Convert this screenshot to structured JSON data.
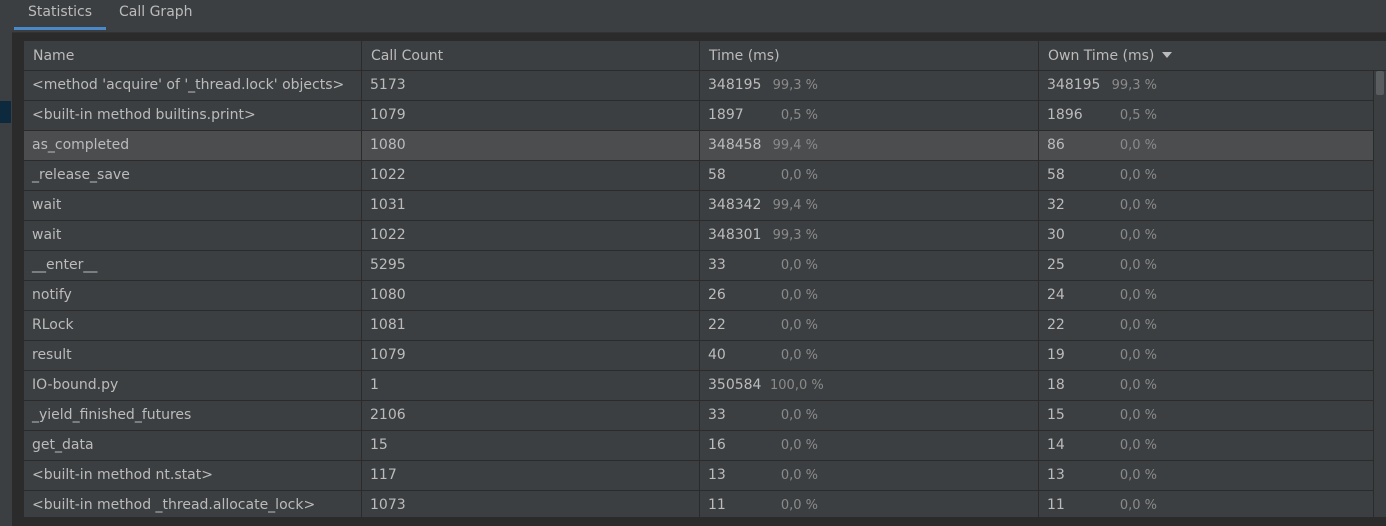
{
  "tabs": [
    {
      "label": "Statistics",
      "active": true
    },
    {
      "label": "Call Graph",
      "active": false
    }
  ],
  "columns": {
    "name": "Name",
    "call_count": "Call Count",
    "time": "Time (ms)",
    "own_time": "Own Time (ms)"
  },
  "rows": [
    {
      "name": "<method 'acquire' of '_thread.lock' objects>",
      "call_count": "5173",
      "time": "348195",
      "time_pct": "99,3 %",
      "own": "348195",
      "own_pct": "99,3 %"
    },
    {
      "name": "<built-in method builtins.print>",
      "call_count": "1079",
      "time": "1897",
      "time_pct": "0,5 %",
      "own": "1896",
      "own_pct": "0,5 %"
    },
    {
      "name": "as_completed",
      "call_count": "1080",
      "time": "348458",
      "time_pct": "99,4 %",
      "own": "86",
      "own_pct": "0,0 %"
    },
    {
      "name": "_release_save",
      "call_count": "1022",
      "time": "58",
      "time_pct": "0,0 %",
      "own": "58",
      "own_pct": "0,0 %"
    },
    {
      "name": "wait",
      "call_count": "1031",
      "time": "348342",
      "time_pct": "99,4 %",
      "own": "32",
      "own_pct": "0,0 %"
    },
    {
      "name": "wait",
      "call_count": "1022",
      "time": "348301",
      "time_pct": "99,3 %",
      "own": "30",
      "own_pct": "0,0 %"
    },
    {
      "name": "__enter__",
      "call_count": "5295",
      "time": "33",
      "time_pct": "0,0 %",
      "own": "25",
      "own_pct": "0,0 %"
    },
    {
      "name": "notify",
      "call_count": "1080",
      "time": "26",
      "time_pct": "0,0 %",
      "own": "24",
      "own_pct": "0,0 %"
    },
    {
      "name": "RLock",
      "call_count": "1081",
      "time": "22",
      "time_pct": "0,0 %",
      "own": "22",
      "own_pct": "0,0 %"
    },
    {
      "name": "result",
      "call_count": "1079",
      "time": "40",
      "time_pct": "0,0 %",
      "own": "19",
      "own_pct": "0,0 %"
    },
    {
      "name": "IO-bound.py",
      "call_count": "1",
      "time": "350584",
      "time_pct": "100,0 %",
      "own": "18",
      "own_pct": "0,0 %"
    },
    {
      "name": "_yield_finished_futures",
      "call_count": "2106",
      "time": "33",
      "time_pct": "0,0 %",
      "own": "15",
      "own_pct": "0,0 %"
    },
    {
      "name": "get_data",
      "call_count": "15",
      "time": "16",
      "time_pct": "0,0 %",
      "own": "14",
      "own_pct": "0,0 %"
    },
    {
      "name": "<built-in method nt.stat>",
      "call_count": "117",
      "time": "13",
      "time_pct": "0,0 %",
      "own": "13",
      "own_pct": "0,0 %"
    },
    {
      "name": "<built-in method _thread.allocate_lock>",
      "call_count": "1073",
      "time": "11",
      "time_pct": "0,0 %",
      "own": "11",
      "own_pct": "0,0 %"
    }
  ],
  "selected_row_index": 2,
  "sort_column": "own_time",
  "sort_direction": "descending",
  "colors": {
    "accent": "#4a88c7",
    "background": "#3c3f41",
    "selected_row": "#4b4d4f",
    "grid": "#2b2b2b"
  }
}
